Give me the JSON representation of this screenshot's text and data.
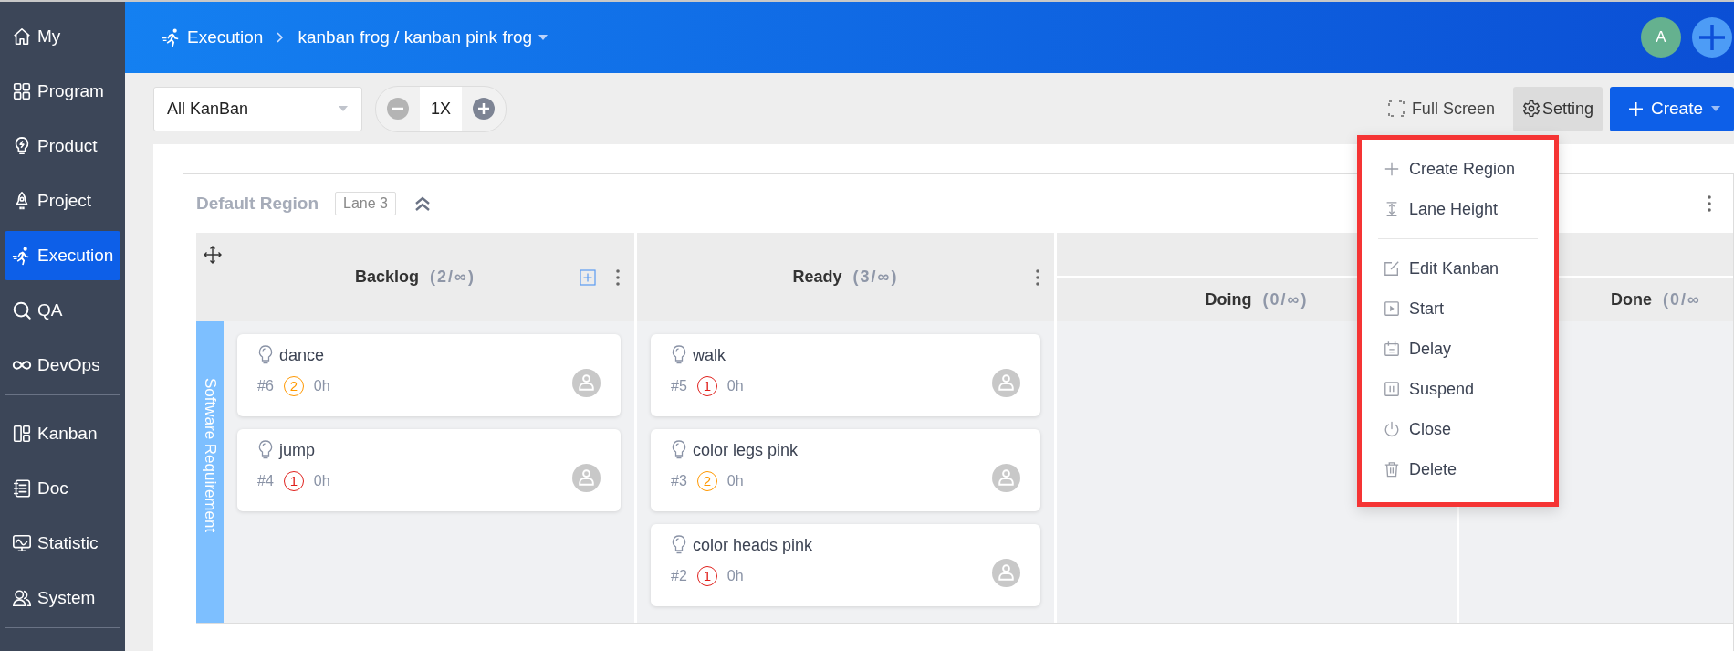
{
  "sidebar": {
    "groups": [
      [
        {
          "label": "My",
          "kind": "home",
          "selected": false
        },
        {
          "label": "Program",
          "kind": "grid",
          "selected": false
        },
        {
          "label": "Product",
          "kind": "bulb",
          "selected": false
        },
        {
          "label": "Project",
          "kind": "rocket",
          "selected": false
        },
        {
          "label": "Execution",
          "kind": "run",
          "selected": true
        },
        {
          "label": "QA",
          "kind": "search",
          "selected": false
        },
        {
          "label": "DevOps",
          "kind": "infinity",
          "selected": false
        }
      ],
      [
        {
          "label": "Kanban",
          "kind": "kanban",
          "selected": false
        },
        {
          "label": "Doc",
          "kind": "doc",
          "selected": false
        },
        {
          "label": "Statistic",
          "kind": "monitor",
          "selected": false
        },
        {
          "label": "System",
          "kind": "users",
          "selected": false
        }
      ]
    ]
  },
  "header": {
    "module": "Execution",
    "title": "kanban frog / kanban pink frog",
    "avatar": "A"
  },
  "toolbar": {
    "kanban_select": "All KanBan",
    "zoom": "1X",
    "full_screen": "Full Screen",
    "setting": {
      "label": "Setting",
      "active": true
    },
    "create": "Create"
  },
  "region": {
    "name": "Default Region",
    "lane_tag": "Lane 3"
  },
  "lane": {
    "name": "Software Requirement"
  },
  "columns": [
    {
      "kind": "single",
      "name": "Backlog",
      "count": "(2/∞)",
      "add_button": true,
      "cards": [
        {
          "title": "dance",
          "id": "#6",
          "priority": {
            "label": "2",
            "color": "#ff9800"
          },
          "hours": "0h"
        },
        {
          "title": "jump",
          "id": "#4",
          "priority": {
            "label": "1",
            "color": "#e0201c"
          },
          "hours": "0h"
        }
      ]
    },
    {
      "kind": "single",
      "name": "Ready",
      "count": "(3/∞)",
      "add_button": false,
      "cards": [
        {
          "title": "walk",
          "id": "#5",
          "priority": {
            "label": "1",
            "color": "#e0201c"
          },
          "hours": "0h"
        },
        {
          "title": "color legs pink",
          "id": "#3",
          "priority": {
            "label": "2",
            "color": "#ff9800"
          },
          "hours": "0h"
        },
        {
          "title": "color heads pink",
          "id": "#2",
          "priority": {
            "label": "1",
            "color": "#e0201c"
          },
          "hours": "0h"
        }
      ]
    },
    {
      "kind": "group",
      "children": [
        {
          "name": "Doing",
          "count": "(0/∞)"
        },
        {
          "name": "Done",
          "count": "(0/∞"
        }
      ]
    }
  ],
  "setting_menu": {
    "groups": [
      [
        {
          "label": "Create Region",
          "kind": "plus"
        },
        {
          "label": "Lane Height",
          "kind": "height"
        }
      ],
      [
        {
          "label": "Edit Kanban",
          "kind": "edit"
        },
        {
          "label": "Start",
          "kind": "play"
        },
        {
          "label": "Delay",
          "kind": "calendar"
        },
        {
          "label": "Suspend",
          "kind": "pause"
        },
        {
          "label": "Close",
          "kind": "power"
        },
        {
          "label": "Delete",
          "kind": "trash"
        }
      ]
    ]
  }
}
